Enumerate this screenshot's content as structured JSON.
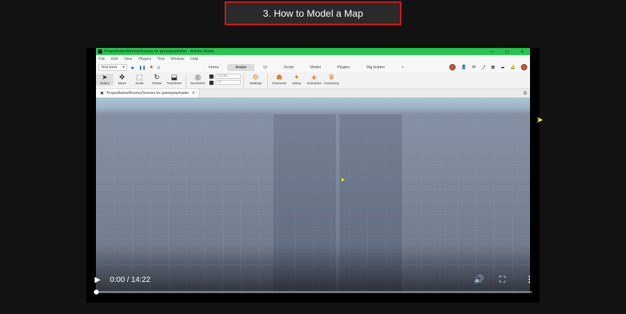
{
  "heading": {
    "text": "3. How to Model a Map",
    "border_color": "#e0141e"
  },
  "studio": {
    "window_title": "Props/Anims/Rooms/Scenes for gameplay/trailer - Roblox Studio",
    "titlebar_color": "#25c64e",
    "window_controls": [
      "—",
      "▢",
      "✕"
    ],
    "menu": [
      "File",
      "Edit",
      "View",
      "Plugins",
      "Test",
      "Window",
      "Help"
    ],
    "test_dropdown": "Test Here",
    "ribbon_tabs": [
      "Home",
      "Avatar",
      "UI",
      "Script",
      "Model",
      "Plugins",
      "Rig builder"
    ],
    "active_tab": "Avatar",
    "tools": [
      {
        "label": "Select",
        "icon": "cursor-icon",
        "glyph": "➤"
      },
      {
        "label": "Move",
        "icon": "move-icon",
        "glyph": "✥"
      },
      {
        "label": "Scale",
        "icon": "scale-icon",
        "glyph": "⬚"
      },
      {
        "label": "Rotate",
        "icon": "rotate-icon",
        "glyph": "↻"
      },
      {
        "label": "Transform",
        "icon": "transform-icon",
        "glyph": "⬓"
      },
      {
        "label": "Geometric",
        "icon": "geometric-icon",
        "glyph": "◎"
      }
    ],
    "snap": {
      "move_value": "0.1 st...",
      "rotate_value": "1°"
    },
    "avatar_tools": [
      {
        "label": "Settings",
        "icon": "settings-icon",
        "glyph": "⚙"
      },
      {
        "label": "Character",
        "icon": "character-icon",
        "glyph": "☗"
      },
      {
        "label": "Setup",
        "icon": "setup-icon",
        "glyph": "✦"
      },
      {
        "label": "Animation",
        "icon": "animation-icon",
        "glyph": "◈"
      },
      {
        "label": "Accessory",
        "icon": "accessory-icon",
        "glyph": "♛"
      }
    ],
    "doc_tab": "Props/Anims/Rooms/Scenes for gameplay/trailer"
  },
  "video": {
    "current_time": "0:00",
    "duration": "14:22",
    "time_display": "0:00 / 14:22",
    "progress_percent": 0
  }
}
